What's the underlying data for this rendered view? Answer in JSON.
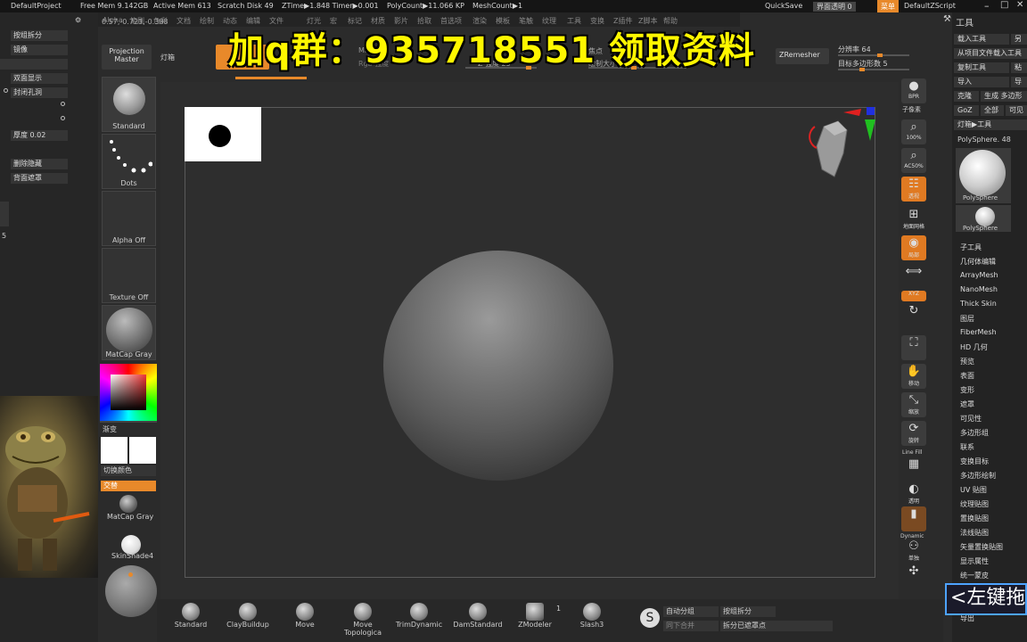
{
  "titlebar": {
    "project": "DefaultProject",
    "freemem": "Free Mem 9.142GB",
    "activemem": "Active Mem 613",
    "scratch": "Scratch Disk 49",
    "ztime": "ZTime▶1.848 Timer▶0.001",
    "polycount": "PolyCount▶11.066 KP",
    "meshcount": "MeshCount▶1",
    "quicksave": "QuickSave",
    "transparency": "界面透明 0",
    "menu": "菜单",
    "script": "DefaultZScript"
  },
  "menubar": [
    "Alpha",
    "笔刷",
    "色彩",
    "文档",
    "绘制",
    "动态",
    "编辑",
    "文件",
    "灯光",
    "宏",
    "标记",
    "材质",
    "影片",
    "拾取",
    "首选项",
    "渲染",
    "模板",
    "笔触",
    "纹理",
    "工具",
    "变换",
    "Z插件",
    "Z脚本",
    "帮助"
  ],
  "leftpanel": {
    "coords": "0.57,-0.723,-0.388",
    "split": "按组拆分",
    "mirror": "镜像",
    "doubleside": "双面显示",
    "closeholes": "封闭孔洞",
    "thickness": "厚度 0.02",
    "delhidden": "删除隐藏",
    "backmask": "背面遮罩",
    "num5": "5"
  },
  "brushes": {
    "standard": "Standard",
    "dots": "Dots",
    "alpha": "Alpha Off",
    "texture": "Texture Off",
    "matcap": "MatCap Gray",
    "gradient": "渐变",
    "switchcolor": "切换颜色",
    "alternate": "交替",
    "matcap2": "MatCap Gray",
    "skinshade": "SkinShade4"
  },
  "topstrip": {
    "projection": "Projection Master",
    "lightbox": "灯箱",
    "zremesher": "ZRemesher",
    "subdiv": "分辨率 64",
    "targetpoly": "目标多边形数 5",
    "mrgb": "Mrgb",
    "rgb": "Rgb 强度",
    "zintensity": "Z 强度 25",
    "focal": "焦点",
    "drawsize": "绘制大小"
  },
  "promo": "加q群：935718551 领取资料",
  "rightbar": {
    "bpr": "BPR",
    "subpixel": "子像素",
    "zoom": "100%",
    "ac50": "AC50%",
    "frame": "透视",
    "floor": "地面网格",
    "local": "局部",
    "xyz": "XYZ",
    "move": "移动",
    "scale": "缩放",
    "rotate": "旋转",
    "linefill": "Line Fill",
    "transp": "透明",
    "dynamic": "Dynamic",
    "solo": "单独"
  },
  "toolpanel": {
    "title": "工具",
    "load": "载入工具",
    "saveas": "另存为",
    "import_proj": "从项目文件载入工具",
    "copy": "复制工具",
    "paste": "粘贴",
    "import": "导入",
    "export": "导出",
    "clone": "克隆",
    "make_polymesh": "生成 多边形网格",
    "goz": "GoZ",
    "all": "全部",
    "visible": "可见",
    "lightbox_tool": "灯箱▶工具",
    "current": "PolySphere. 48",
    "thumb1": "PolySphere",
    "thumb2": "PolySphere",
    "items": [
      "子工具",
      "几何体编辑",
      "ArrayMesh",
      "NanoMesh",
      "Thick Skin",
      "图层",
      "FiberMesh",
      "HD 几何",
      "预览",
      "表面",
      "变形",
      "遮罩",
      "可见性",
      "多边形组",
      "联系",
      "变换目标",
      "多边形绘制",
      "UV 贴图",
      "纹理贴图",
      "置换贴图",
      "法线贴图",
      "矢量置换贴图",
      "显示属性",
      "统一蒙皮",
      "导出"
    ]
  },
  "bottombar": {
    "brushes": [
      "Standard",
      "ClayBuildup",
      "Move",
      "Move Topologica",
      "TrimDynamic",
      "DamStandard",
      "ZModeler",
      "Slash3"
    ],
    "count": "1",
    "autogroup": "自动分组",
    "weldcollinear": "同下合并",
    "splitgroup": "按组拆分",
    "splitpoints": "拆分已遮罩点"
  },
  "hint": "<左键拖"
}
